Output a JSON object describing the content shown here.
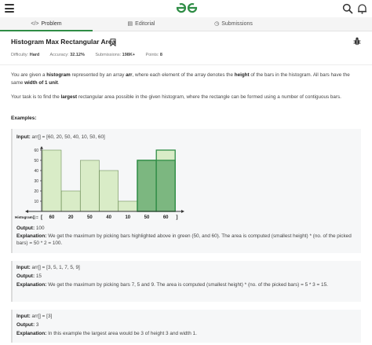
{
  "header": {
    "logo_text": "GfG",
    "brand_color": "#2f8d46"
  },
  "tabs": [
    {
      "label": "Problem",
      "icon": "code-icon",
      "active": true
    },
    {
      "label": "Editorial",
      "icon": "book-icon",
      "active": false
    },
    {
      "label": "Submissions",
      "icon": "clock-icon",
      "active": false
    }
  ],
  "problem": {
    "title": "Histogram Max Rectangular Area",
    "meta": {
      "difficulty_label": "Difficulty:",
      "difficulty": "Hard",
      "accuracy_label": "Accuracy:",
      "accuracy": "32.12%",
      "submissions_label": "Submissions:",
      "submissions": "198K+",
      "points_label": "Points:",
      "points": "8"
    },
    "description": {
      "p1_a": "You are given a ",
      "p1_b": "histogram",
      "p1_c": " represented by an array ",
      "p1_d": "arr",
      "p1_e": ", where each element of the array denotes the ",
      "p1_f": "height",
      "p1_g": " of the bars in the histogram. All bars have the same ",
      "p1_h": "width of 1 unit",
      "p1_i": ".",
      "p2_a": "Your task is to find the ",
      "p2_b": "largest",
      "p2_c": " rectangular area possible in the given histogram, where the rectangle can be formed using a number of contiguous bars."
    },
    "examples_heading": "Examples:",
    "examples": [
      {
        "input_label": "Input:",
        "input": "arr[] = [60, 20, 50, 40, 10, 50, 60]",
        "output_label": "Output:",
        "output": "100",
        "explanation_label": "Explanation:",
        "explanation": "We get the maximum by picking bars highlighted above in green (50, and 60). The area is computed (smallest height) * (no. of the picked bars) = 50 * 2 = 100."
      },
      {
        "input_label": "Input:",
        "input": "arr[] = [3, 5, 1, 7, 5, 9]",
        "output_label": "Output:",
        "output": "15",
        "explanation_label": "Explanation:",
        "explanation": "We get the maximum by picking bars 7, 5 and 9. The area is computed (smallest height) * (no. of the picked bars) = 5 * 3 = 15."
      },
      {
        "input_label": "Input:",
        "input": "arr[] = [3]",
        "output_label": "Output:",
        "output": "3",
        "explanation_label": "Explanation:",
        "explanation": "In this example the largest area would be 3 of height 3 and width 1."
      }
    ]
  },
  "chart_data": {
    "type": "bar",
    "categories": [
      "60",
      "20",
      "50",
      "40",
      "10",
      "50",
      "60"
    ],
    "values": [
      60,
      20,
      50,
      40,
      10,
      50,
      60
    ],
    "highlighted": [
      5,
      6
    ],
    "ylim": [
      0,
      60
    ],
    "yticks": [
      0,
      10,
      20,
      30,
      40,
      50,
      60
    ],
    "xlabel": "Histogram[] =",
    "bracket_left": "[",
    "bracket_right": "]",
    "bar_color": "#d9ecc7",
    "highlight_color": "#2f8d46"
  }
}
